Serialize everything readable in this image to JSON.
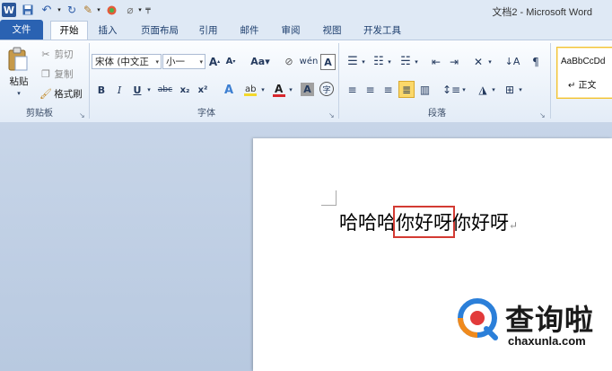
{
  "window": {
    "title": "文档2 - Microsoft Word"
  },
  "quick_access": {
    "app_icon": "W",
    "save_icon": "save-icon",
    "undo_icon": "undo-icon",
    "redo_icon": "redo-icon"
  },
  "tabs": [
    "文件",
    "开始",
    "插入",
    "页面布局",
    "引用",
    "邮件",
    "审阅",
    "视图",
    "开发工具"
  ],
  "ribbon": {
    "clipboard": {
      "paste": "粘贴",
      "cut": "剪切",
      "copy": "复制",
      "format_painter": "格式刷",
      "group": "剪贴板"
    },
    "font": {
      "font_name": "宋体 (中文正",
      "font_size": "小一",
      "bold": "B",
      "italic": "I",
      "underline": "U",
      "strike": "abc",
      "subscript": "x₂",
      "superscript": "x²",
      "group": "字体"
    },
    "paragraph": {
      "group": "段落"
    },
    "styles": {
      "preview": "AaBbCcDd",
      "normal": "↵ 正文"
    }
  },
  "document": {
    "before": "哈哈哈",
    "selected": "你好呀",
    "after": "你好呀",
    "para_mark": "↵"
  },
  "watermark": {
    "cn": "查询啦",
    "en": "chaxunla.com"
  },
  "colors": {
    "file_tab": "#2a62b2",
    "selection_box": "#d33b33",
    "highlight_yellow": "#f4d82b",
    "font_red": "#d8262c"
  }
}
